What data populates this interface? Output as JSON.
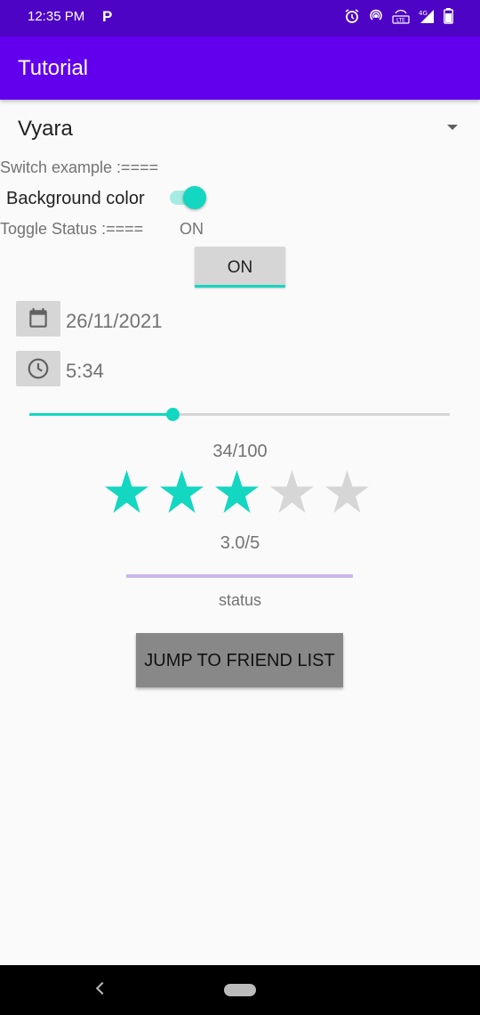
{
  "status_bar": {
    "time": "12:35 PM",
    "carrier_icon_text": "P",
    "icons": [
      "alarm-icon",
      "hotspot-icon",
      "volte-icon",
      "signal-icon",
      "battery-icon"
    ],
    "background": "#4e04c5"
  },
  "app_bar": {
    "title": "Tutorial",
    "background": "#6200ee"
  },
  "spinner": {
    "selected": "Vyara"
  },
  "switch_section": {
    "heading": "Switch example :====",
    "switch_label": "Background color",
    "switch_on": true,
    "accent_color": "#13d7c0"
  },
  "toggle_section": {
    "status_label": "Toggle Status :====",
    "status_value": "ON",
    "button_label": "ON"
  },
  "date_time": {
    "date_icon": "calendar-icon",
    "date_value": "26/11/2021",
    "time_icon": "clock-icon",
    "time_value": "5:34"
  },
  "seekbar": {
    "value": 34,
    "max": 100,
    "display": "34/100"
  },
  "rating": {
    "value": 3.0,
    "max": 5,
    "display": "3.0/5",
    "filled_color": "#13d7c0",
    "empty_color": "#d6d6d6"
  },
  "progress": {
    "status_text": "status",
    "color": "#cbb8ea"
  },
  "jump_button": {
    "label": "JUMP TO FRIEND LIST"
  },
  "nav_bar": {
    "icons": [
      "back-icon",
      "home-pill-icon"
    ]
  }
}
